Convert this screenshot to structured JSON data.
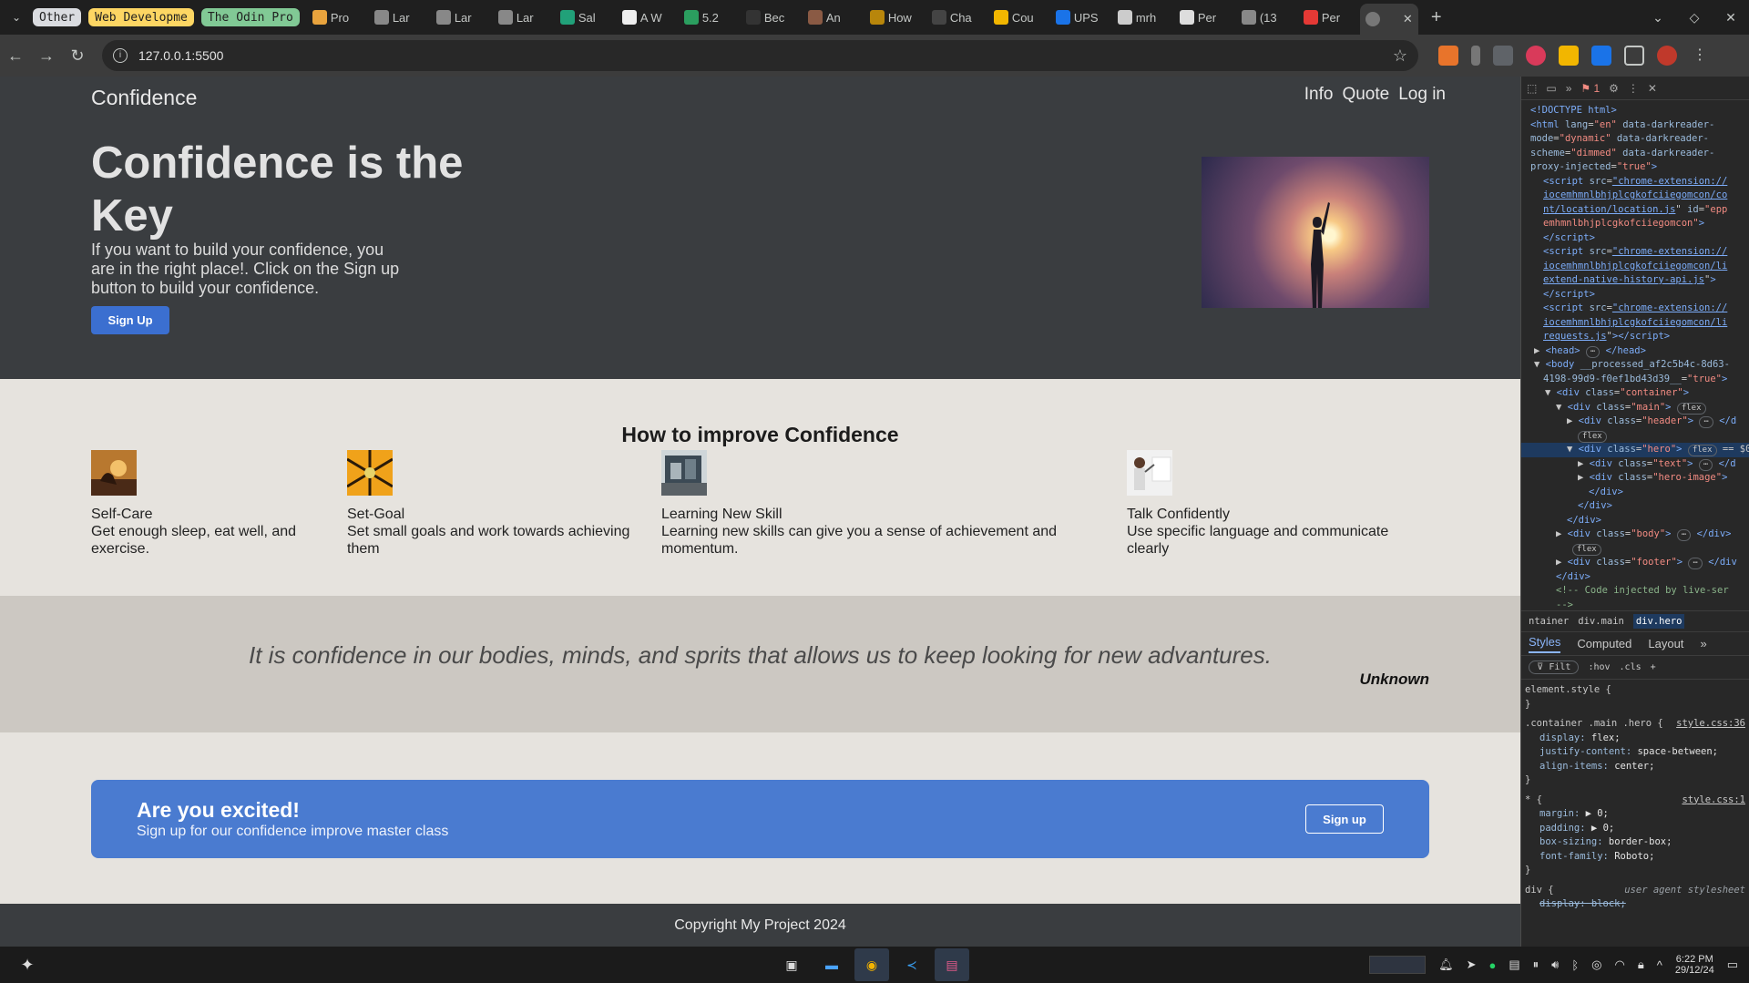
{
  "browser": {
    "tabs": [
      {
        "label": "Other",
        "kind": "group",
        "color": "gray"
      },
      {
        "label": "Web Developme",
        "kind": "group",
        "color": "yellow"
      },
      {
        "label": "The Odin Pro",
        "kind": "group",
        "color": "green"
      },
      {
        "label": "Pro",
        "kind": "tab"
      },
      {
        "label": "Lar",
        "kind": "tab"
      },
      {
        "label": "Lar",
        "kind": "tab"
      },
      {
        "label": "Lar",
        "kind": "tab"
      },
      {
        "label": "Sal",
        "kind": "tab"
      },
      {
        "label": "A W",
        "kind": "tab"
      },
      {
        "label": "5.2",
        "kind": "tab"
      },
      {
        "label": "Bec",
        "kind": "tab"
      },
      {
        "label": "An",
        "kind": "tab"
      },
      {
        "label": "How",
        "kind": "tab"
      },
      {
        "label": "Cha",
        "kind": "tab"
      },
      {
        "label": "Cou",
        "kind": "tab"
      },
      {
        "label": "UPS",
        "kind": "tab"
      },
      {
        "label": "mrh",
        "kind": "tab"
      },
      {
        "label": "Per",
        "kind": "tab"
      },
      {
        "label": "(13",
        "kind": "tab"
      },
      {
        "label": "Per",
        "kind": "tab"
      }
    ],
    "url": "127.0.0.1:5500"
  },
  "site": {
    "logo": "Confidence",
    "nav": [
      "Info",
      "Quote",
      "Log in"
    ],
    "hero": {
      "title": "Confidence is the Key",
      "text": "If you want to build your confidence, you are in the right place!. Click on the Sign up button to build your confidence.",
      "button": "Sign Up"
    },
    "improve": {
      "title": "How to improve Confidence",
      "cards": [
        {
          "title": "Self-Care",
          "desc": "Get enough sleep, eat well, and exercise."
        },
        {
          "title": "Set-Goal",
          "desc": "Set small goals and work towards achieving them"
        },
        {
          "title": "Learning New Skill",
          "desc": "Learning new skills can give you a sense of achievement and momentum."
        },
        {
          "title": "Talk Confidently",
          "desc": "Use specific language and communicate clearly"
        }
      ]
    },
    "quote": {
      "text": "It is confidence in our bodies, minds, and sprits that allows us to keep looking for new advantures.",
      "author": "Unknown"
    },
    "cta": {
      "title": "Are you excited!",
      "subtitle": "Sign up for our confidence improve master class",
      "button": "Sign up"
    },
    "footer": "Copyright My Project 2024"
  },
  "devtools": {
    "error_count": "1",
    "breadcrumbs": [
      "ntainer",
      "div.main",
      "div.hero"
    ],
    "panel_tabs": [
      "Styles",
      "Computed",
      "Layout"
    ],
    "filter_placeholder": "Filt",
    "filter_buttons": [
      ":hov",
      ".cls"
    ],
    "rule1_selector": "element.style {",
    "rule2_selector": ".container .main .hero {",
    "rule2_source": "style.css:36",
    "rule2_props": [
      {
        "name": "display",
        "value": "flex;"
      },
      {
        "name": "justify-content",
        "value": "space-between;"
      },
      {
        "name": "align-items",
        "value": "center;"
      }
    ],
    "rule3_selector": "* {",
    "rule3_source": "style.css:1",
    "rule3_props": [
      {
        "name": "margin",
        "value": "▶ 0;"
      },
      {
        "name": "padding",
        "value": "▶ 0;"
      },
      {
        "name": "box-sizing",
        "value": "border-box;"
      },
      {
        "name": "font-family",
        "value": "Roboto;"
      }
    ],
    "rule4_selector": "div {",
    "rule4_note": "user agent stylesheet",
    "rule4_prop": "display: block;"
  },
  "taskbar": {
    "time": "6:22 PM",
    "date": "29/12/24"
  }
}
